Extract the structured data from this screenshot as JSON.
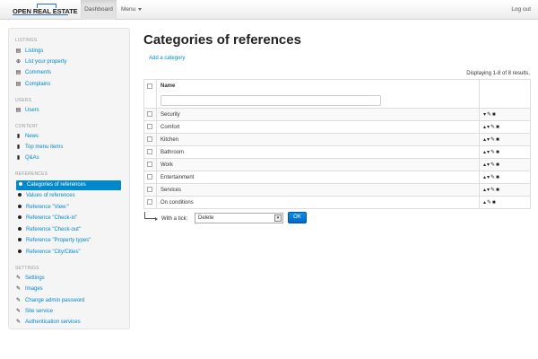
{
  "navbar": {
    "logo_text": "OPEN REAL ESTATE",
    "dashboard": "Dashboard",
    "menu": "Menu",
    "logout": "Log out"
  },
  "sidebar": {
    "sections": [
      {
        "header": "LISTINGS",
        "items": [
          {
            "label": "Listings",
            "icon": "list-icon"
          },
          {
            "label": "List your property",
            "icon": "plus-circle-icon"
          },
          {
            "label": "Comments",
            "icon": "list-icon"
          },
          {
            "label": "Complains",
            "icon": "list-icon"
          }
        ]
      },
      {
        "header": "USERS",
        "items": [
          {
            "label": "Users",
            "icon": "list-icon"
          }
        ]
      },
      {
        "header": "CONTENT",
        "items": [
          {
            "label": "News",
            "icon": "file-icon"
          },
          {
            "label": "Top menu items",
            "icon": "file-icon"
          },
          {
            "label": "Q&As",
            "icon": "file-icon"
          }
        ]
      },
      {
        "header": "REFERENCES",
        "items": [
          {
            "label": "Categories of references",
            "icon": "bullet-icon",
            "active": true
          },
          {
            "label": "Values of references",
            "icon": "bullet-icon"
          },
          {
            "label": "Reference \"View:\"",
            "icon": "bullet-icon"
          },
          {
            "label": "Reference \"Check-in\"",
            "icon": "bullet-icon"
          },
          {
            "label": "Reference \"Check-out\"",
            "icon": "bullet-icon"
          },
          {
            "label": "Reference \"Property types\"",
            "icon": "bullet-icon"
          },
          {
            "label": "Reference \"City/Cities\"",
            "icon": "bullet-icon"
          }
        ]
      },
      {
        "header": "SETTINGS",
        "items": [
          {
            "label": "Settings",
            "icon": "wrench-icon"
          },
          {
            "label": "Images",
            "icon": "wrench-icon"
          },
          {
            "label": "Change admin password",
            "icon": "wrench-icon"
          },
          {
            "label": "Site service",
            "icon": "wrench-icon"
          },
          {
            "label": "Authentication services",
            "icon": "wrench-icon"
          }
        ]
      }
    ]
  },
  "main": {
    "title": "Categories of references",
    "add_link": "Add a category",
    "result_count": "Displaying 1-8 of 8 results.",
    "column_name": "Name",
    "rows": [
      {
        "name": "Security",
        "up": false,
        "down": true
      },
      {
        "name": "Comfort",
        "up": true,
        "down": true
      },
      {
        "name": "Kitchen",
        "up": true,
        "down": true
      },
      {
        "name": "Bathroom",
        "up": true,
        "down": true
      },
      {
        "name": "Work",
        "up": true,
        "down": true
      },
      {
        "name": "Entertainment",
        "up": true,
        "down": true
      },
      {
        "name": "Services",
        "up": true,
        "down": true
      },
      {
        "name": "On conditions",
        "up": true,
        "down": false
      }
    ],
    "bulk": {
      "label": "With a tick:",
      "selected": "Delete",
      "ok": "OK"
    }
  },
  "colors": {
    "link": "#0088cc",
    "active_bg": "#0088cc",
    "button": "#0066cc"
  }
}
